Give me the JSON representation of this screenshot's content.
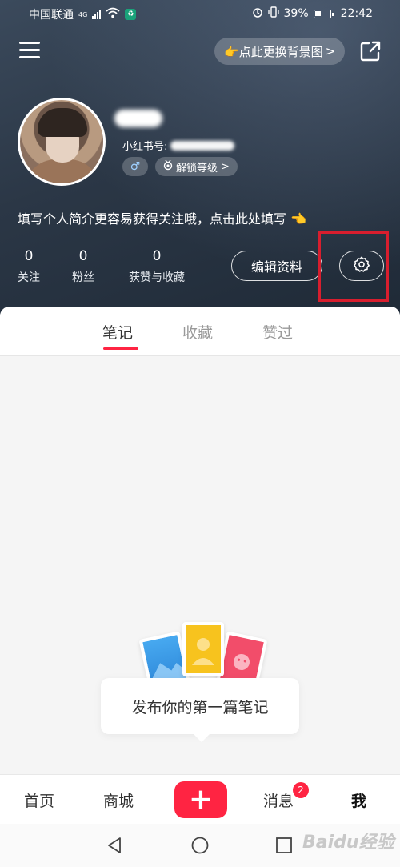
{
  "status_bar": {
    "carrier": "中国联通",
    "network": "4G",
    "battery": "39%",
    "time": "22:42"
  },
  "header": {
    "change_bg_label": "👉点此更换背景图",
    "change_bg_chevron": ">"
  },
  "profile": {
    "red_id_label": "小红书号:",
    "gender_symbol": "♂",
    "level_label": "解锁等级",
    "level_chevron": ">",
    "bio": "填写个人简介更容易获得关注哦，点击此处填写 👈",
    "stats": [
      {
        "value": "0",
        "label": "关注"
      },
      {
        "value": "0",
        "label": "粉丝"
      },
      {
        "value": "0",
        "label": "获赞与收藏"
      }
    ],
    "edit_label": "编辑资料"
  },
  "tabs": [
    {
      "label": "笔记",
      "active": true
    },
    {
      "label": "收藏",
      "active": false
    },
    {
      "label": "赞过",
      "active": false
    }
  ],
  "empty_state": {
    "message": "发布你的第一篇笔记"
  },
  "bottom_nav": {
    "items": [
      {
        "label": "首页"
      },
      {
        "label": "商城"
      },
      {
        "label": "消息"
      },
      {
        "label": "我"
      }
    ],
    "publish_symbol": "+",
    "messages_badge": "2"
  },
  "watermark": "Baidu经验",
  "colors": {
    "accent": "#ff2442",
    "highlight": "#d81e2e",
    "header_bg": "#2b3746"
  }
}
